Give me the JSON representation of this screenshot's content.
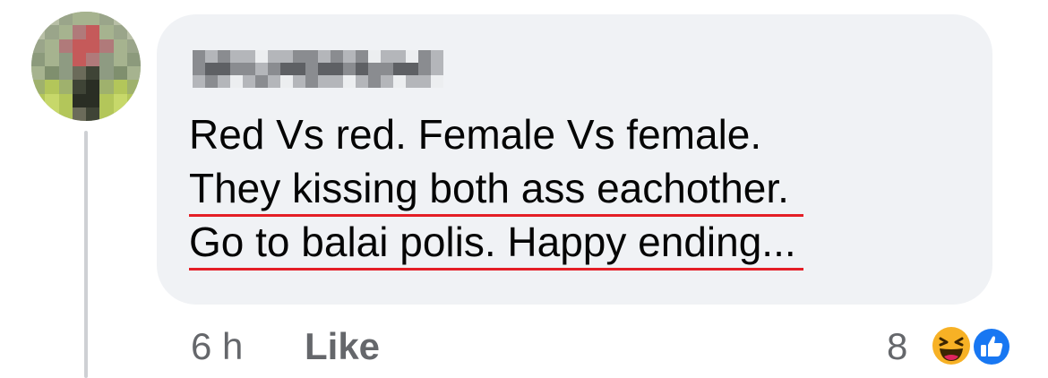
{
  "comment": {
    "author_name": "Hidden Name",
    "lines": [
      "Red Vs red. Female Vs female.",
      "They kissing both ass eachother.",
      "Go to balai polis. Happy ending..."
    ]
  },
  "footer": {
    "timestamp": "6 h",
    "like_label": "Like",
    "reaction_count": "8"
  },
  "reactions": [
    "haha-reaction-icon",
    "like-reaction-icon"
  ],
  "colors": {
    "bubble": "#f0f2f5",
    "text": "#050505",
    "secondary": "#65676b",
    "underline": "#e41e26",
    "like_blue": "#1877f2",
    "haha_yellow": "#f7b125"
  }
}
